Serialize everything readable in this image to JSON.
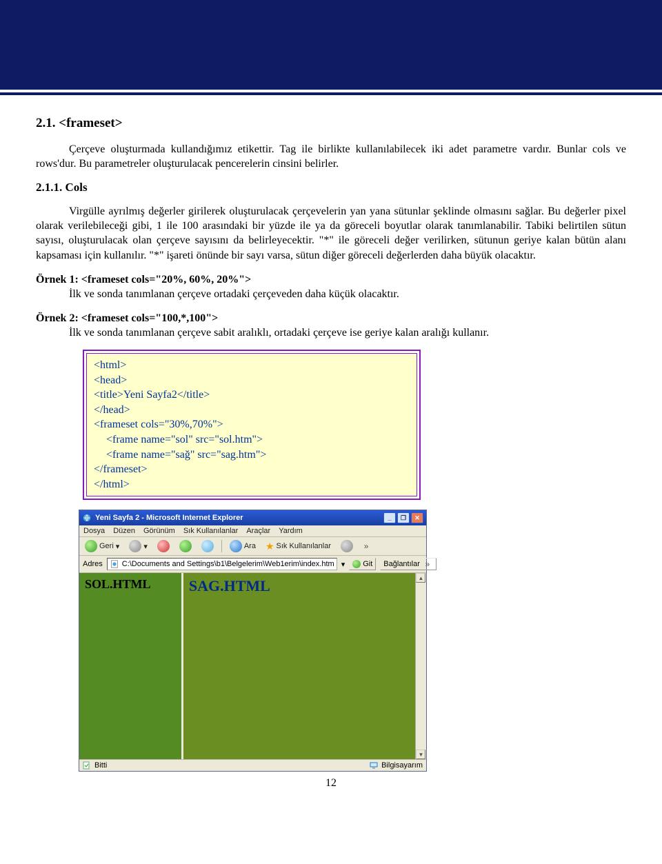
{
  "section": {
    "number": "2.1.",
    "title": "<frameset>",
    "intro": "Çerçeve oluşturmada kullandığımız etikettir. Tag ile birlikte kullanılabilecek iki adet parametre vardır. Bunlar cols ve rows'dur. Bu parametreler oluşturulacak pencerelerin cinsini belirler."
  },
  "subsection": {
    "number": "2.1.1.",
    "title": "Cols",
    "body": "Virgülle ayrılmış değerler girilerek oluşturulacak çerçevelerin yan yana sütunlar şeklinde olmasını sağlar. Bu değerler pixel olarak verilebileceği gibi, 1 ile 100 arasındaki bir yüzde ile ya da göreceli boyutlar olarak tanımlanabilir. Tabiki belirtilen sütun sayısı, oluşturulacak olan çerçeve sayısını da belirleyecektir. \"*\" ile göreceli değer verilirken, sütunun geriye kalan bütün alanı kapsaması için kullanılır. \"*\" işareti önünde bir sayı varsa, sütun diğer göreceli değerlerden daha büyük olacaktır."
  },
  "examples": [
    {
      "label": "Örnek 1:",
      "code_inline": "<frameset cols=\"20%, 60%, 20%\">",
      "desc": "İlk ve sonda tanımlanan çerçeve ortadaki çerçeveden daha küçük olacaktır."
    },
    {
      "label": "Örnek 2:",
      "code_inline": "<frameset cols=\"100,*,100\">",
      "desc_prefix": "İlk ve sonda tanımlanan çerçeve sabit aralıklı, ortadaki çerçeve ise geriye kalan aralığı",
      "desc_trail": "kullanır."
    }
  ],
  "codebox": {
    "lines": [
      "<html>",
      "<head>",
      "<title>Yeni Sayfa2</title>",
      "</head>",
      "<frameset cols=\"30%,70%\">",
      "  <frame name=\"sol\" src=\"sol.htm\">",
      "  <frame name=\"sağ\" src=\"sag.htm\">",
      "</frameset>",
      "</html>"
    ]
  },
  "browser": {
    "title": "Yeni Sayfa 2 - Microsoft Internet Explorer",
    "menu": [
      "Dosya",
      "Düzen",
      "Görünüm",
      "Sık Kullanılanlar",
      "Araçlar",
      "Yardım"
    ],
    "toolbar": {
      "back": "Geri",
      "search": "Ara",
      "favorites": "Sık Kullanılanlar"
    },
    "address": {
      "label": "Adres",
      "value": "C:\\Documents and Settings\\b1\\Belgelerim\\Web1erim\\index.htm",
      "go": "Git",
      "links": "Bağlantılar"
    },
    "frames": {
      "left": "SOL.HTML",
      "right": "SAG.HTML"
    },
    "status": {
      "left": "Bitti",
      "right": "Bilgisayarım"
    }
  },
  "page_number": "12"
}
